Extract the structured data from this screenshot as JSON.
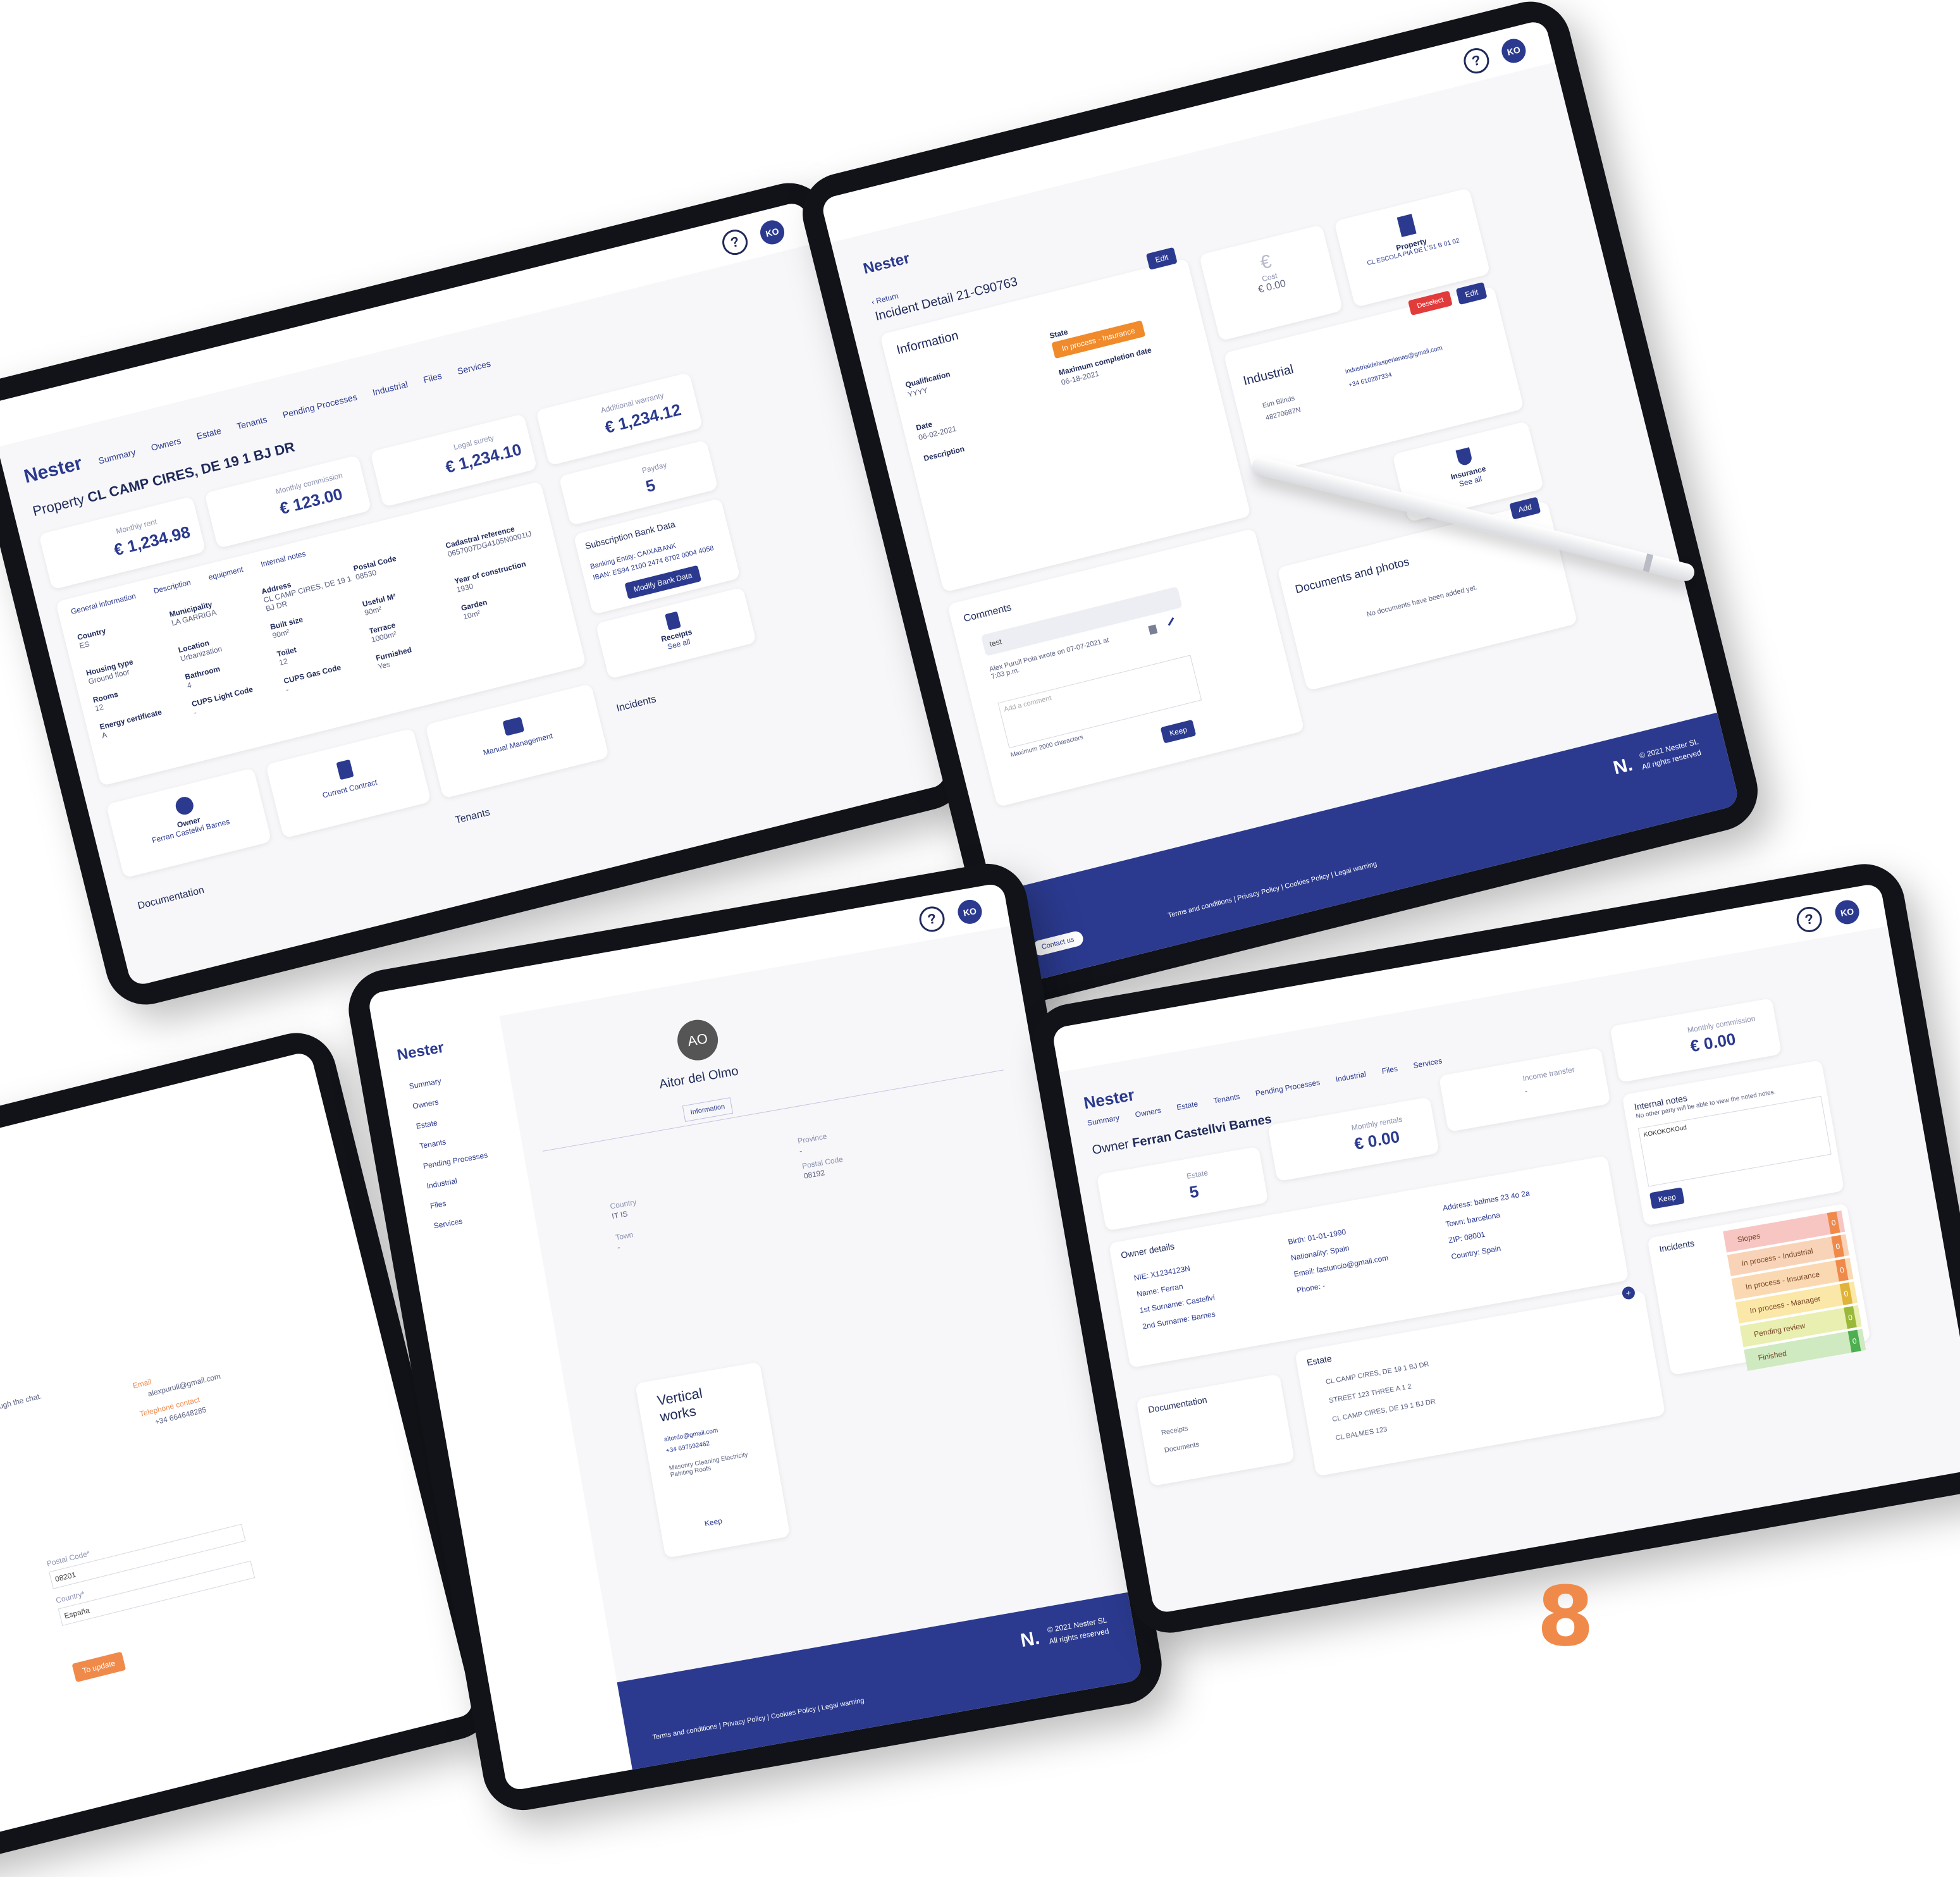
{
  "brand": {
    "logo": "Nester",
    "help": "?",
    "avatar": "KO",
    "footer_copy": "© 2021 Nester SL",
    "footer_rights": "All rights reserved",
    "footer_links": "Terms and conditions | Privacy Policy | Cookies Policy | Legal warning",
    "contact": "Contact us"
  },
  "nav": {
    "summary": "Summary",
    "owners": "Owners",
    "estate": "Estate",
    "tenants": "Tenants",
    "pending": "Pending Processes",
    "industrial": "Industrial",
    "files": "Files",
    "services": "Services"
  },
  "property": {
    "title_prefix": "Property",
    "title": "CL CAMP CIRES, DE 19 1 BJ DR",
    "monthly_rent_label": "Monthly rent",
    "monthly_rent": "€ 1,234.98",
    "monthly_commission_label": "Monthly commission",
    "monthly_commission": "€ 123.00",
    "legal_surety_label": "Legal surety",
    "legal_surety": "€ 1,234.10",
    "additional_warranty_label": "Additional warranty",
    "additional_warranty": "€ 1,234.12",
    "payday_label": "Payday",
    "payday": "5",
    "tabs": [
      "General information",
      "Description",
      "equipment",
      "Internal notes"
    ],
    "fields": [
      {
        "k": "Country",
        "v": "ES"
      },
      {
        "k": "Municipality",
        "v": "LA GARRIGA"
      },
      {
        "k": "Address",
        "v": "CL CAMP CIRES, DE 19 1 BJ DR"
      },
      {
        "k": "Postal Code",
        "v": "08530"
      },
      {
        "k": "Cadastral reference",
        "v": "0657007DG4105N0001IJ"
      },
      {
        "k": "Housing type",
        "v": "Ground floor"
      },
      {
        "k": "Location",
        "v": "Urbanization"
      },
      {
        "k": "Built size",
        "v": "90m²"
      },
      {
        "k": "Useful M²",
        "v": "90m²"
      },
      {
        "k": "Year of construction",
        "v": "1930"
      },
      {
        "k": "Rooms",
        "v": "12"
      },
      {
        "k": "Bathroom",
        "v": "4"
      },
      {
        "k": "Toilet",
        "v": "12"
      },
      {
        "k": "Terrace",
        "v": "1000m²"
      },
      {
        "k": "Garden",
        "v": "10m²"
      },
      {
        "k": "Energy certificate",
        "v": "A"
      },
      {
        "k": "CUPS Light Code",
        "v": "-"
      },
      {
        "k": "CUPS Gas Code",
        "v": "-"
      },
      {
        "k": "Furnished",
        "v": "Yes"
      }
    ],
    "bank_title": "Subscription Bank Data",
    "bank_entity": "Banking Entity: CAIXABANK",
    "iban": "IBAN: ES94 2100 2474 6702 0004 4058",
    "modify_btn": "Modify Bank Data",
    "receipts": "Receipts",
    "see_all": "See all",
    "owner_label": "Owner",
    "owner_name": "Ferran Castellví Barnes",
    "current_contract": "Current Contract",
    "manual_management": "Manual Management",
    "incidents": "Incidents",
    "tenants": "Tenants",
    "documentation": "Documentation"
  },
  "incident": {
    "return": "‹ Return",
    "title": "Incident Detail 21-C90763",
    "edit": "Edit",
    "information": "Information",
    "qualification_label": "Qualification",
    "qualification": "YYYY",
    "state_label": "State",
    "state": "In process - Insurance",
    "max_date_label": "Maximum completion date",
    "max_date": "06-18-2021",
    "date_label": "Date",
    "date": "06-02-2021",
    "description_label": "Description",
    "cost_label": "Cost",
    "cost": "€ 0.00",
    "property_label": "Property",
    "property": "CL ESCOLA PIA DE L'S1 B 01 02",
    "deselect": "Deselect",
    "industrial": "Industrial",
    "company": "Eim Blinds",
    "phone_id": "48270687N",
    "email": "industrialdelasperianas@gmail.com",
    "phone": "+34 610287334",
    "insurance": "Insurance",
    "comments": "Comments",
    "comment_text": "test",
    "comment_meta": "Alex Purull Pola wrote on 07-07-2021 at 7:03 p.m.",
    "add_comment": "Add a comment",
    "max_chars": "Maximum 2000 characters",
    "keep": "Keep",
    "docs_title": "Documents and photos",
    "add": "Add",
    "no_docs": "No documents have been added yet."
  },
  "partial": {
    "through_chat": "ough the chat.",
    "email_label": "Email",
    "email": "alexpurull@gmail.com",
    "tel_label": "Telephone contact",
    "tel": "+34 664648285",
    "postal_label": "Postal Code*",
    "postal": "08201",
    "country_label": "Country*",
    "country": "España",
    "update_btn": "To update"
  },
  "industrial_profile": {
    "initials": "AO",
    "name": "Aitor del Olmo",
    "tab": "Information",
    "province_label": "Province",
    "province": "-",
    "country_label": "Country",
    "country": "IT IS",
    "postal_label": "Postal Code",
    "postal": "08192",
    "town_label": "Town",
    "town": "-",
    "card_title": "Vertical works",
    "email": "aitordo@gmail.com",
    "phone": "+34 697592462",
    "services": "Masonry  Cleaning  Electricity  Painting  Roofs",
    "keep": "Keep"
  },
  "owner": {
    "title_prefix": "Owner",
    "title": "Ferran Castellvi Barnes",
    "monthly_commission_label": "Monthly commission",
    "monthly_commission": "€ 0.00",
    "income_label": "Income transfer",
    "income": "-",
    "monthly_rentals_label": "Monthly rentals",
    "monthly_rentals": "€ 0.00",
    "estate_label": "Estate",
    "estate": "5",
    "notes_title": "Internal notes",
    "notes_sub": "No other party will be able to view the noted notes.",
    "notes_text": "KOKOKOKOud",
    "keep": "Keep",
    "details_title": "Owner details",
    "nie": "NIE: X1234123N",
    "first_name": "Name: Ferran",
    "surname1": "1st Surname: Castellví",
    "surname2": "2nd Surname: Barnes",
    "birth": "Birth: 01-01-1990",
    "nationality": "Nationality: Spain",
    "email": "Email: fastuncio@gmail.com",
    "phone": "Phone: -",
    "address": "Address: balmes 23 4o 2a",
    "town": "Town: barcelona",
    "zip": "ZIP: 08001",
    "country": "Country: Spain",
    "incidents_title": "Incidents",
    "incident_rows": [
      {
        "label": "Slopes",
        "count": "0",
        "color": "#f7c6c3"
      },
      {
        "label": "In process - Industrial",
        "count": "0",
        "color": "#f9d3b7"
      },
      {
        "label": "In process - Insurance",
        "count": "0",
        "color": "#fad9b2"
      },
      {
        "label": "In process - Manager",
        "count": "0",
        "color": "#fbe7a8"
      },
      {
        "label": "Pending review",
        "count": "0",
        "color": "#e9efb0"
      },
      {
        "label": "Finished",
        "count": "0",
        "color": "#cfe9c0"
      }
    ],
    "documentation": "Documentation",
    "docs": [
      "Receipts",
      "Documents"
    ],
    "estate_title": "Estate",
    "estates": [
      "CL CAMP CIRES, DE 19 1 BJ DR",
      "STREET 123 THREE A 1 2",
      "CL CAMP CIRES, DE 19 1 BJ DR",
      "CL BALMES 123"
    ]
  },
  "page_number": "8"
}
